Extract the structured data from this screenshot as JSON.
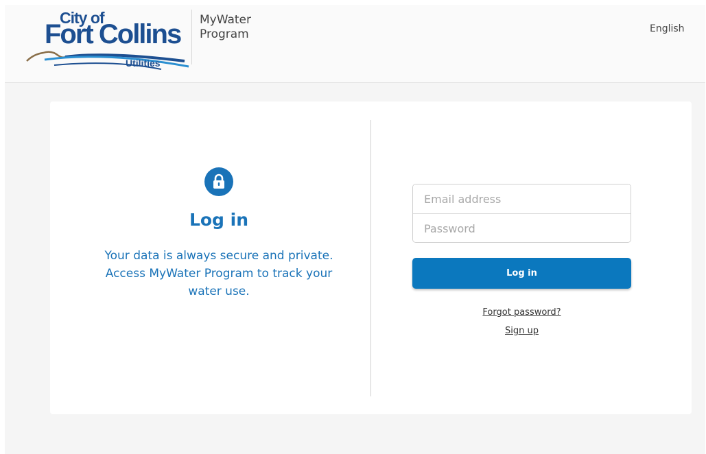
{
  "header": {
    "logo": {
      "line1": "City of",
      "line2": "Fort Collins",
      "line3": "Utilities"
    },
    "program_name": "MyWater Program",
    "language": "English"
  },
  "login_panel": {
    "icon": "lock-icon",
    "title": "Log in",
    "description": "Your data is always secure and private. Access MyWater Program to track your water use."
  },
  "form": {
    "email_placeholder": "Email address",
    "email_value": "",
    "password_placeholder": "Password",
    "password_value": "",
    "submit_label": "Log in",
    "forgot_label": "Forgot password?",
    "signup_label": "Sign up"
  },
  "colors": {
    "accent": "#1a73b8",
    "button": "#0b78be",
    "brand": "#1d4f91"
  }
}
